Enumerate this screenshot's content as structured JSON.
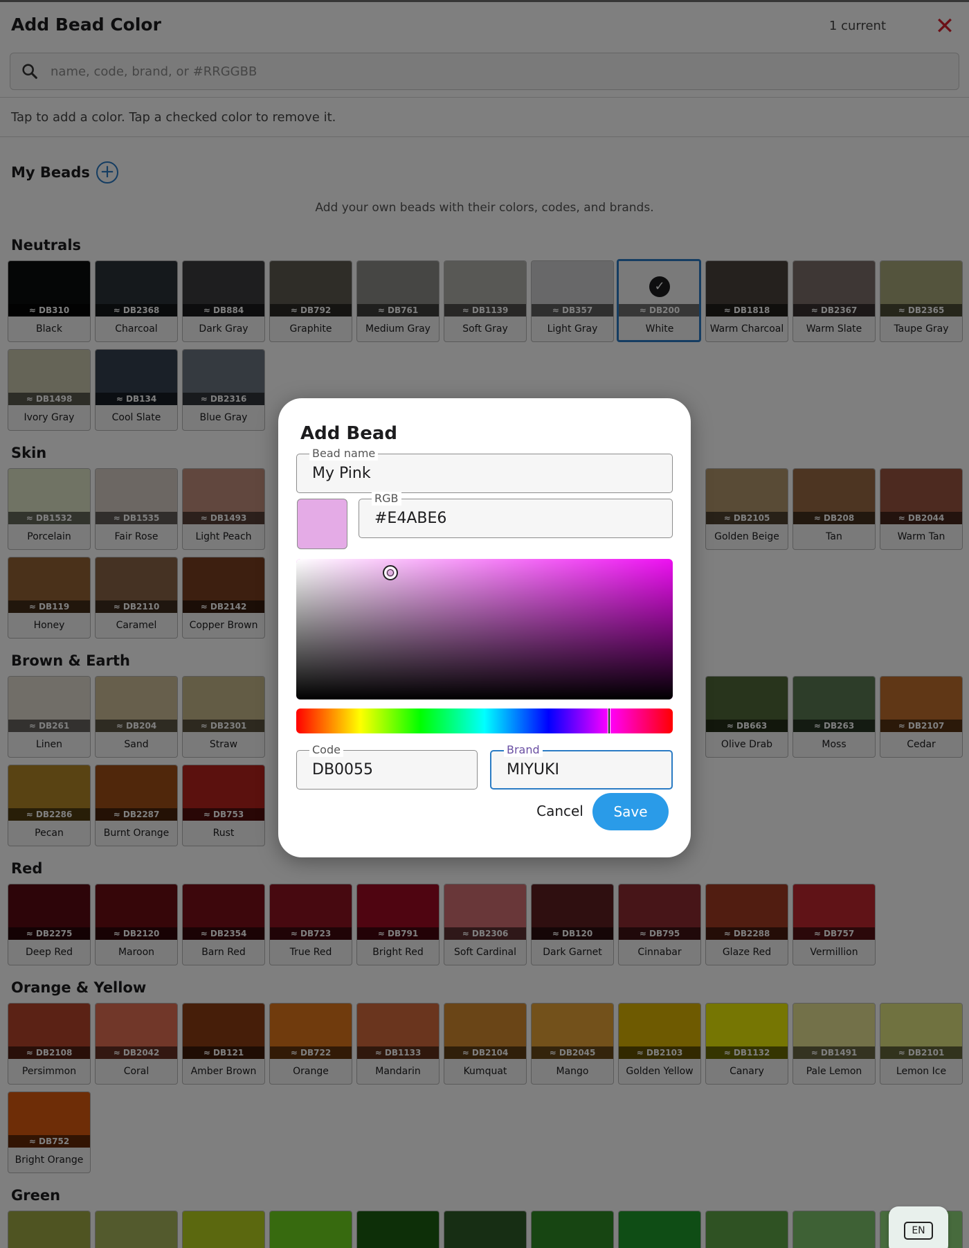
{
  "header": {
    "title": "Add Bead Color",
    "current_count": "1 current",
    "close_icon": "close-icon",
    "accent_color": "#d8202f"
  },
  "search": {
    "placeholder": "name, code, brand, or #RRGGBB",
    "value": ""
  },
  "hint": "Tap to add a color. Tap a checked color to remove it.",
  "my_beads": {
    "title": "My Beads",
    "empty_text": "Add your own beads with their colors, codes, and brands."
  },
  "sections": [
    {
      "title": "Neutrals",
      "swatches": [
        {
          "code": "≈ DB310",
          "name": "Black",
          "color": "#0b0c0d"
        },
        {
          "code": "≈ DB2368",
          "name": "Charcoal",
          "color": "#2a3238"
        },
        {
          "code": "≈ DB884",
          "name": "Dark Gray",
          "color": "#3c3d3f"
        },
        {
          "code": "≈ DB792",
          "name": "Graphite",
          "color": "#5e5b51"
        },
        {
          "code": "≈ DB761",
          "name": "Medium Gray",
          "color": "#8c8c88"
        },
        {
          "code": "≈ DB1139",
          "name": "Soft Gray",
          "color": "#b1b0aa"
        },
        {
          "code": "≈ DB357",
          "name": "Light Gray",
          "color": "#d0d0d2"
        },
        {
          "code": "≈ DB200",
          "name": "White",
          "color": "#f5f5f5",
          "selected": true
        },
        {
          "code": "≈ DB1818",
          "name": "Warm Charcoal",
          "color": "#4a433c"
        },
        {
          "code": "≈ DB2367",
          "name": "Warm Slate",
          "color": "#7c6e6a"
        },
        {
          "code": "≈ DB2365",
          "name": "Taupe Gray",
          "color": "#a9a87a"
        },
        {
          "code": "≈ DB1498",
          "name": "Ivory Gray",
          "color": "#cbc8ae"
        },
        {
          "code": "≈ DB134",
          "name": "Cool Slate",
          "color": "#344050"
        },
        {
          "code": "≈ DB2316",
          "name": "Blue Gray",
          "color": "#6a7480"
        }
      ]
    },
    {
      "title": "Skin",
      "swatches": [
        {
          "code": "≈ DB1532",
          "name": "Porcelain",
          "color": "#e0e6c8"
        },
        {
          "code": "≈ DB1535",
          "name": "Fair Rose",
          "color": "#d9cfc6"
        },
        {
          "code": "≈ DB1493",
          "name": "Light Peach",
          "color": "#c38f7c"
        },
        {
          "code": "≈ DB2105",
          "name": "Golden Beige",
          "color": "#b3966c"
        },
        {
          "code": "≈ DB208",
          "name": "Tan",
          "color": "#9a6b44"
        },
        {
          "code": "≈ DB2044",
          "name": "Warm Tan",
          "color": "#9b5441"
        },
        {
          "code": "≈ DB119",
          "name": "Honey",
          "color": "#946335"
        },
        {
          "code": "≈ DB2110",
          "name": "Caramel",
          "color": "#8a6446"
        },
        {
          "code": "≈ DB2142",
          "name": "Copper Brown",
          "color": "#7a3e20"
        }
      ]
    },
    {
      "title": "Brown & Earth",
      "swatches": [
        {
          "code": "≈ DB261",
          "name": "Linen",
          "color": "#e2dcd0"
        },
        {
          "code": "≈ DB204",
          "name": "Sand",
          "color": "#cfbe98"
        },
        {
          "code": "≈ DB2301",
          "name": "Straw",
          "color": "#c7b88b"
        },
        {
          "code": "≈ DB663",
          "name": "Olive Drab",
          "color": "#506838"
        },
        {
          "code": "≈ DB263",
          "name": "Moss",
          "color": "#5a7a52"
        },
        {
          "code": "≈ DB2107",
          "name": "Cedar",
          "color": "#c06f2c"
        },
        {
          "code": "≈ DB2286",
          "name": "Pecan",
          "color": "#b28726"
        },
        {
          "code": "≈ DB2287",
          "name": "Burnt Orange",
          "color": "#a04e17"
        },
        {
          "code": "≈ DB753",
          "name": "Rust",
          "color": "#b7221d"
        }
      ]
    },
    {
      "title": "Red",
      "swatches": [
        {
          "code": "≈ DB2275",
          "name": "Deep Red",
          "color": "#5a0a12"
        },
        {
          "code": "≈ DB2120",
          "name": "Maroon",
          "color": "#6d0d12"
        },
        {
          "code": "≈ DB2354",
          "name": "Barn Red",
          "color": "#7a0f18"
        },
        {
          "code": "≈ DB723",
          "name": "True Red",
          "color": "#8e1220"
        },
        {
          "code": "≈ DB791",
          "name": "Bright Red",
          "color": "#9e0a22"
        },
        {
          "code": "≈ DB2306",
          "name": "Soft Cardinal",
          "color": "#d26e72"
        },
        {
          "code": "≈ DB120",
          "name": "Dark Garnet",
          "color": "#5f1e20"
        },
        {
          "code": "≈ DB795",
          "name": "Cinnabar",
          "color": "#8e2a30"
        },
        {
          "code": "≈ DB2288",
          "name": "Glaze Red",
          "color": "#a23a22"
        },
        {
          "code": "≈ DB757",
          "name": "Vermillion",
          "color": "#c0272f"
        }
      ]
    },
    {
      "title": "Orange & Yellow",
      "swatches": [
        {
          "code": "≈ DB2108",
          "name": "Persimmon",
          "color": "#b6442a"
        },
        {
          "code": "≈ DB2042",
          "name": "Coral",
          "color": "#e36e52"
        },
        {
          "code": "≈ DB121",
          "name": "Amber Brown",
          "color": "#8d3d12"
        },
        {
          "code": "≈ DB722",
          "name": "Orange",
          "color": "#e0771b"
        },
        {
          "code": "≈ DB1133",
          "name": "Mandarin",
          "color": "#d56a3c"
        },
        {
          "code": "≈ DB2104",
          "name": "Kumquat",
          "color": "#d58a2f"
        },
        {
          "code": "≈ DB2045",
          "name": "Mango",
          "color": "#e7a236"
        },
        {
          "code": "≈ DB2103",
          "name": "Golden Yellow",
          "color": "#ddb503"
        },
        {
          "code": "≈ DB1132",
          "name": "Canary",
          "color": "#ecec07"
        },
        {
          "code": "≈ DB1491",
          "name": "Pale Lemon",
          "color": "#e6e393"
        },
        {
          "code": "≈ DB2101",
          "name": "Lemon Ice",
          "color": "#e0e580"
        },
        {
          "code": "≈ DB752",
          "name": "Bright Orange",
          "color": "#dd5a0f"
        }
      ]
    },
    {
      "title": "Green",
      "swatches": [
        {
          "code": "",
          "name": "",
          "color": "#9ea845"
        },
        {
          "code": "",
          "name": "",
          "color": "#a7b55a"
        },
        {
          "code": "",
          "name": "",
          "color": "#b6d01e"
        },
        {
          "code": "",
          "name": "",
          "color": "#6ed41f"
        },
        {
          "code": "",
          "name": "",
          "color": "#1a5e10"
        },
        {
          "code": "",
          "name": "",
          "color": "#2f5c28"
        },
        {
          "code": "",
          "name": "",
          "color": "#2f8a24"
        },
        {
          "code": "",
          "name": "",
          "color": "#1e9b2a"
        },
        {
          "code": "",
          "name": "",
          "color": "#5fa446"
        },
        {
          "code": "",
          "name": "",
          "color": "#7cc26a"
        },
        {
          "code": "",
          "name": "",
          "color": "#8fd67a"
        }
      ]
    }
  ],
  "dialog": {
    "title": "Add Bead",
    "bead_name_label": "Bead name",
    "bead_name_value": "My Pink",
    "rgb_label": "RGB",
    "rgb_value": "#E4ABE6",
    "preview_color": "#e4abe6",
    "picker": {
      "hue_fraction": 0.83,
      "saturation": 0.25,
      "value": 0.9,
      "hue_color": "#ee10f2"
    },
    "code_label": "Code",
    "code_value": "DB0055",
    "brand_label": "Brand",
    "brand_value": "MIYUKI",
    "cancel_label": "Cancel",
    "save_label": "Save",
    "save_color": "#2a9be8"
  },
  "language_button": {
    "label": "EN"
  }
}
